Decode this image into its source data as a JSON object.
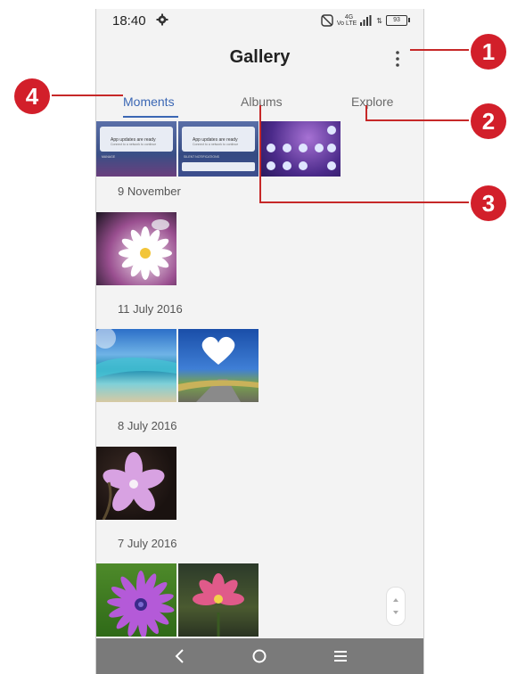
{
  "status_bar": {
    "time": "18:40",
    "network": "Vo LTE",
    "network_gen": "4G",
    "battery": "93"
  },
  "app": {
    "title": "Gallery"
  },
  "tabs": [
    {
      "label": "Moments",
      "active": true
    },
    {
      "label": "Albums",
      "active": false
    },
    {
      "label": "Explore",
      "active": false
    }
  ],
  "sections": [
    {
      "date": "9 November"
    },
    {
      "date": "11 July 2016"
    },
    {
      "date": "8 July 2016"
    },
    {
      "date": "7 July 2016"
    }
  ],
  "notification_thumbs": [
    {
      "title": "App updates are ready",
      "subtitle": "Connect to a network to continue",
      "footer": "MANAGE"
    },
    {
      "title": "App updates are ready",
      "subtitle": "Connect to a network to continue",
      "footer": "SILENT NOTIFICATIONS"
    }
  ],
  "callouts": [
    "1",
    "2",
    "3",
    "4"
  ],
  "colors": {
    "accent": "#3b67b4",
    "callout": "#d21f2a"
  }
}
